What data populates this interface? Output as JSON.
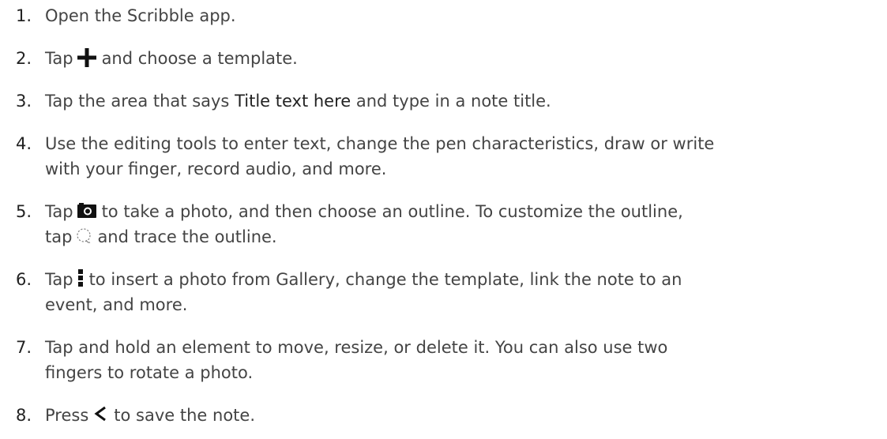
{
  "steps": [
    {
      "num": "1.",
      "parts": {
        "a": "Open the Scribble app."
      }
    },
    {
      "num": "2.",
      "parts": {
        "a": "Tap",
        "b": "and choose a template."
      }
    },
    {
      "num": "3.",
      "parts": {
        "a": "Tap the area that says",
        "term": "Title text here",
        "b": "and type in a note title."
      }
    },
    {
      "num": "4.",
      "parts": {
        "line1": "Use the editing tools to enter text, change the pen characteristics, draw or write",
        "line2": "with your finger, record audio, and more."
      }
    },
    {
      "num": "5.",
      "parts": {
        "a": "Tap",
        "b": "to take a photo, and then choose an outline. To customize the outline,",
        "c": "tap",
        "d": "and trace the outline."
      }
    },
    {
      "num": "6.",
      "parts": {
        "a": "Tap",
        "b": "to insert a photo from Gallery, change the template, link the note to an",
        "c": "event, and more."
      }
    },
    {
      "num": "7.",
      "parts": {
        "line1": "Tap and hold an element to move, resize, or delete it. You can also use two",
        "line2": "fingers to rotate a photo."
      }
    },
    {
      "num": "8.",
      "parts": {
        "a": "Press",
        "b": "to save the note."
      }
    }
  ],
  "icons": {
    "plus": "plus-icon",
    "camera": "camera-icon",
    "lasso": "lasso-icon",
    "menu": "more-vertical-icon",
    "back": "back-chevron-icon"
  }
}
